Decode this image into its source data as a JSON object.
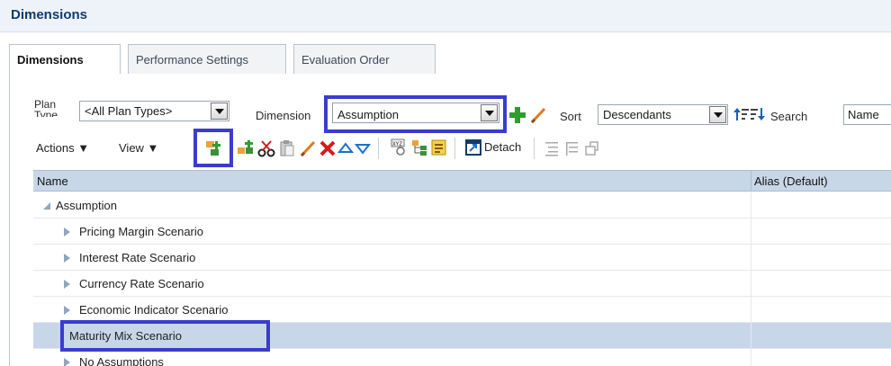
{
  "page": {
    "title": "Dimensions"
  },
  "tabs": [
    {
      "label": "Dimensions",
      "active": true
    },
    {
      "label": "Performance Settings",
      "active": false
    },
    {
      "label": "Evaluation Order",
      "active": false
    }
  ],
  "filters": {
    "plan_type_label_line1": "Plan",
    "plan_type_label_line2": "Type",
    "plan_type_value": "<All Plan Types>",
    "dimension_label": "Dimension",
    "dimension_value": "Assumption",
    "sort_label": "Sort",
    "sort_value": "Descendants",
    "search_label": "Search",
    "search_value": "Name"
  },
  "toolbar": {
    "actions_label": "Actions ▼",
    "view_label": "View ▼",
    "detach_label": "Detach"
  },
  "grid": {
    "columns": [
      "Name",
      "Alias (Default)"
    ],
    "rows": [
      {
        "name": "Assumption",
        "expanded": true,
        "level": 0,
        "selected": false
      },
      {
        "name": "Pricing Margin Scenario",
        "expanded": false,
        "level": 1,
        "selected": false
      },
      {
        "name": "Interest Rate Scenario",
        "expanded": false,
        "level": 1,
        "selected": false
      },
      {
        "name": "Currency Rate Scenario",
        "expanded": false,
        "level": 1,
        "selected": false
      },
      {
        "name": "Economic Indicator Scenario",
        "expanded": false,
        "level": 1,
        "selected": false
      },
      {
        "name": "Maturity Mix Scenario",
        "expanded": null,
        "level": 1,
        "selected": true
      },
      {
        "name": "No Assumptions",
        "expanded": false,
        "level": 1,
        "selected": false
      }
    ]
  },
  "colors": {
    "highlight_border": "#3a3ccf",
    "header_bg": "#c8d7e8",
    "title_color": "#123b6b",
    "add_icon_green": "#2e9e2e",
    "delete_icon_red": "#d21c1c"
  }
}
